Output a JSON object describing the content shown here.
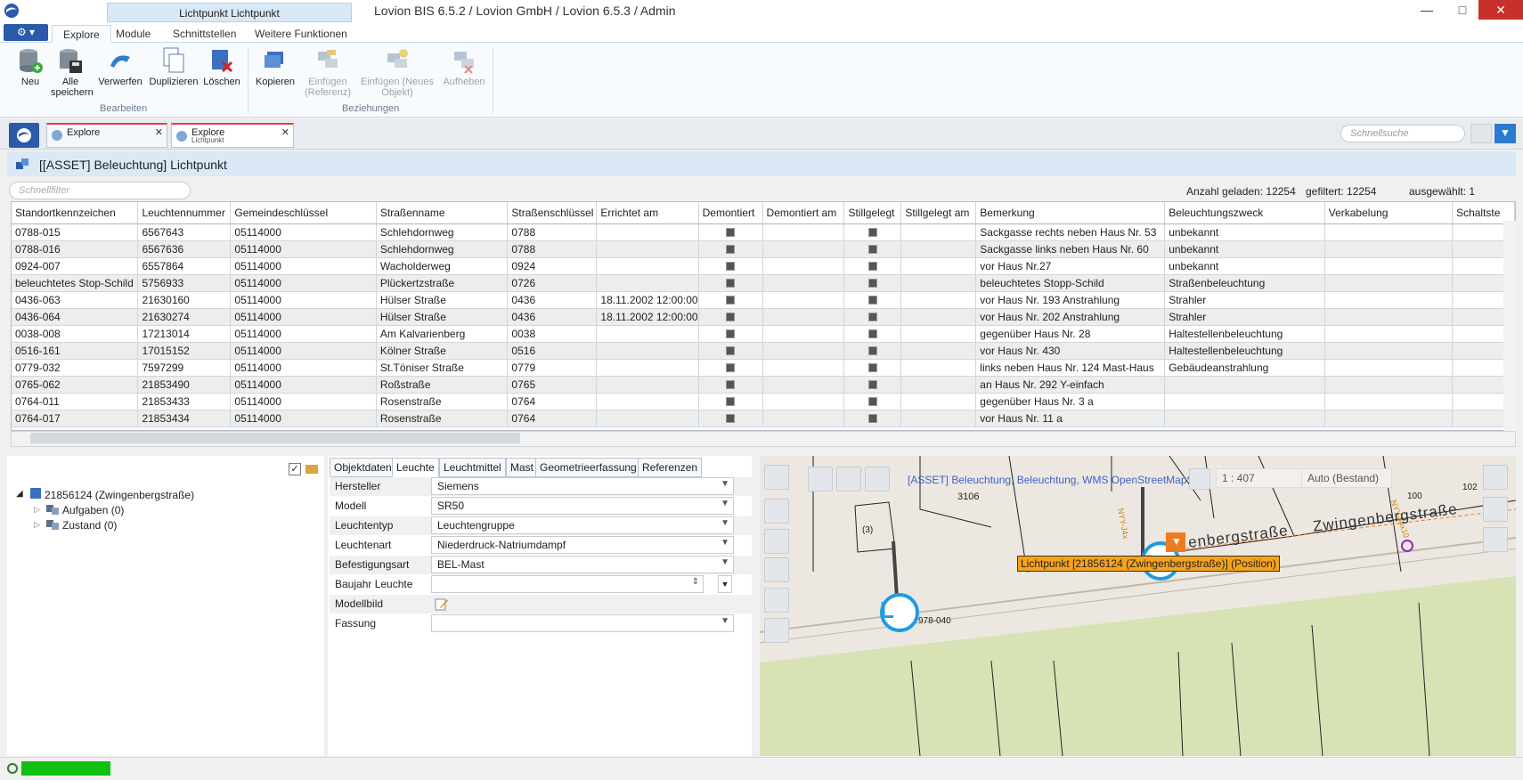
{
  "window": {
    "active_tab_title": "Lichtpunkt Lichtpunkt",
    "title": "Lovion BIS 6.5.2 / Lovion GmbH / Lovion 6.5.3 / Admin",
    "minimize": "—",
    "maximize": "□",
    "close": "✕"
  },
  "ribbon_tabs": [
    "Explore",
    "Module",
    "Schnittstellen",
    "Weitere Funktionen"
  ],
  "ribbon": {
    "groups": {
      "bearbeiten": "Bearbeiten",
      "beziehungen": "Beziehungen"
    },
    "buttons": {
      "neu": "Neu",
      "alle_speichern": "Alle speichern",
      "verwerfen": "Verwerfen",
      "duplizieren": "Duplizieren",
      "loeschen": "Löschen",
      "kopieren": "Kopieren",
      "einfuegen_referenz": "Einfügen (Referenz)",
      "einfuegen_neues_objekt": "Einfügen (Neues Objekt)",
      "aufheben": "Aufheben"
    }
  },
  "doc_tabs": [
    {
      "title": "Explore",
      "subtitle": ""
    },
    {
      "title": "Explore",
      "subtitle": "Lichtpunkt"
    }
  ],
  "quick_search_placeholder": "Schnellsuche",
  "panel_title": "[[ASSET] Beleuchtung] Lichtpunkt",
  "filter_placeholder": "Schnellfilter",
  "counts": {
    "geladen": "Anzahl geladen: 12254",
    "gefiltert": "gefiltert: 12254",
    "ausgewaehlt": "ausgewählt: 1"
  },
  "grid": {
    "columns": [
      "Standortkennzeichen",
      "Leuchtennummer",
      "Gemeindeschlüssel",
      "Straßenname",
      "Straßenschlüssel",
      "Errichtet am",
      "Demontiert",
      "Demontiert am",
      "Stillgelegt",
      "Stillgelegt am",
      "Bemerkung",
      "Beleuchtungszweck",
      "Verkabelung",
      "Schaltste"
    ],
    "rows": [
      [
        "0788-015",
        "6567643",
        "05114000",
        "Schlehdornweg",
        "0788",
        "",
        "",
        "Sackgasse rechts neben Haus Nr. 53",
        "unbekannt"
      ],
      [
        "0788-016",
        "6567636",
        "05114000",
        "Schlehdornweg",
        "0788",
        "",
        "",
        "Sackgasse links neben Haus Nr. 60",
        "unbekannt"
      ],
      [
        "0924-007",
        "6557864",
        "05114000",
        "Wacholderweg",
        "0924",
        "",
        "",
        "vor Haus Nr.27",
        "unbekannt"
      ],
      [
        "beleuchtetes Stop-Schild",
        "5756933",
        "05114000",
        "Plückertzstraße",
        "0726",
        "",
        "",
        "beleuchtetes Stopp-Schild",
        "Straßenbeleuchtung"
      ],
      [
        "0436-063",
        "21630160",
        "05114000",
        "Hülser Straße",
        "0436",
        "18.11.2002 12:00:00",
        "",
        "vor Haus Nr. 193    Anstrahlung",
        "Strahler"
      ],
      [
        "0436-064",
        "21630274",
        "05114000",
        "Hülser Straße",
        "0436",
        "18.11.2002 12:00:00",
        "",
        "vor Haus Nr. 202    Anstrahlung",
        "Strahler"
      ],
      [
        "0038-008",
        "17213014",
        "05114000",
        "Am Kalvarienberg",
        "0038",
        "",
        "",
        "gegenüber Haus Nr. 28",
        "Haltestellenbeleuchtung"
      ],
      [
        "0516-161",
        "17015152",
        "05114000",
        "Kölner Straße",
        "0516",
        "",
        "",
        "vor Haus Nr. 430",
        "Haltestellenbeleuchtung"
      ],
      [
        "0779-032",
        "7597299",
        "05114000",
        "St.Töniser Straße",
        "0779",
        "",
        "",
        "links neben Haus Nr. 124  Mast-Haus",
        "Gebäudeanstrahlung"
      ],
      [
        "0765-062",
        "21853490",
        "05114000",
        "Roßstraße",
        "0765",
        "",
        "",
        "an Haus Nr. 292  Y-einfach",
        ""
      ],
      [
        "0764-011",
        "21853433",
        "05114000",
        "Rosenstraße",
        "0764",
        "",
        "",
        "gegenüber Haus Nr. 3 a",
        ""
      ],
      [
        "0764-017",
        "21853434",
        "05114000",
        "Rosenstraße",
        "0764",
        "",
        "",
        "vor Haus Nr. 11 a",
        ""
      ]
    ]
  },
  "tree": {
    "root": "21856124 (Zwingenbergstraße)",
    "children": [
      "Aufgaben (0)",
      "Zustand (0)"
    ]
  },
  "form_tabs": [
    "Objektdaten",
    "Leuchte",
    "Leuchtmittel",
    "Mast",
    "Geometrieerfassung",
    "Referenzen"
  ],
  "form": {
    "hersteller": {
      "label": "Hersteller",
      "value": "Siemens"
    },
    "modell": {
      "label": "Modell",
      "value": "SR50"
    },
    "leuchtentyp": {
      "label": "Leuchtentyp",
      "value": "Leuchtengruppe"
    },
    "leuchtenart": {
      "label": "Leuchtenart",
      "value": "Niederdruck-Natriumdampf"
    },
    "befestigungsart": {
      "label": "Befestigungsart",
      "value": "BEL-Mast"
    },
    "baujahr": {
      "label": "Baujahr Leuchte",
      "value": ""
    },
    "modellbild": {
      "label": "Modellbild"
    },
    "fassung": {
      "label": "Fassung",
      "value": ""
    }
  },
  "map": {
    "layer_text": "[ASSET] Beleuchtung, Beleuchtung, WMS OpenStreetMap*",
    "scale": "1 : 407",
    "mode": "Auto (Bestand)",
    "street": "Zwingenbergstraße",
    "street_partial": "enbergstraße",
    "tooltip": "Lichtpunkt [21856124 (Zwingenbergstraße)] (Position)",
    "labels": {
      "house_3106": "3106",
      "house_3": "(3)",
      "house_100": "100",
      "house_102": "102",
      "lamp_id": "978-040",
      "cable_1": "NYY-J4x",
      "cable_2": "NYY-J4x10"
    }
  },
  "colors": {
    "accent": "#2a5aa8",
    "tooltip_bg": "#f7a21b",
    "status_green": "#10c010",
    "close_red": "#c7302b"
  }
}
